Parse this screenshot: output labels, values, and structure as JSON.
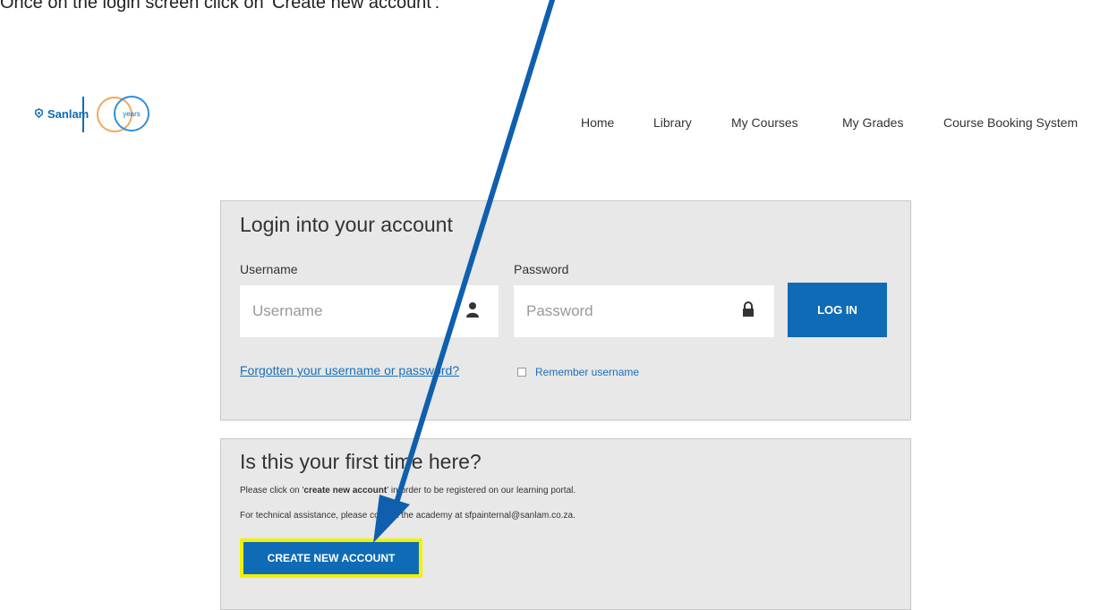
{
  "instruction": "Once on the login screen click on 'Create new account':",
  "header": {
    "logo_text": "Sanlam",
    "logo_badge": "years"
  },
  "nav": {
    "items": [
      {
        "label": "Home"
      },
      {
        "label": "Library"
      },
      {
        "label": "My Courses"
      },
      {
        "label": "My Grades"
      },
      {
        "label": "Course Booking System"
      }
    ]
  },
  "login": {
    "title": "Login into your account",
    "username_label": "Username",
    "username_placeholder": "Username",
    "password_label": "Password",
    "password_placeholder": "Password",
    "login_button": "LOG IN",
    "forgot_link": "Forgotten your username or password?",
    "remember_label": "Remember username"
  },
  "first_time": {
    "title": "Is this your first time here?",
    "line1_pre": "Please click on '",
    "line1_bold": "create new account",
    "line1_post": "' in order to be registered on our learning portal.",
    "line2": "For technical assistance, please contact the academy at sfpainternal@sanlam.co.za.",
    "create_button": "CREATE NEW ACCOUNT"
  },
  "colors": {
    "brand_blue": "#0f6bb5",
    "highlight_yellow": "#f2f200",
    "panel_bg": "#e7e8e7"
  }
}
